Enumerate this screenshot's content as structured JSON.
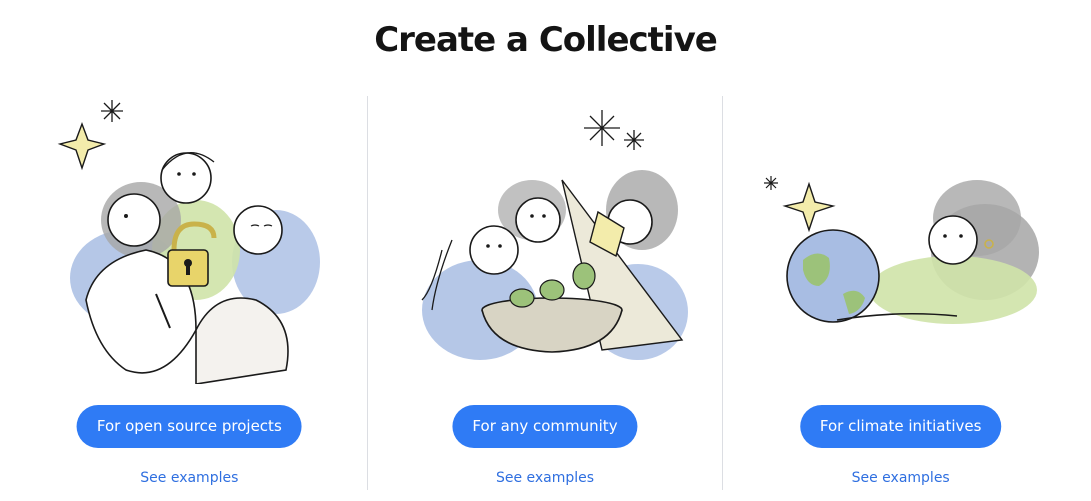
{
  "page": {
    "title": "Create a Collective"
  },
  "cards": [
    {
      "illustration": "people-unlocking-padlock-illustration",
      "button_label": "For open source projects",
      "link_label": "See examples"
    },
    {
      "illustration": "people-sharing-salad-bowl-illustration",
      "button_label": "For any community",
      "link_label": "See examples"
    },
    {
      "illustration": "woman-hugging-earth-illustration",
      "button_label": "For climate initiatives",
      "link_label": "See examples"
    }
  ],
  "colors": {
    "button_bg": "#2f7bf5",
    "link": "#2f6fe0",
    "wash_blue": "#a8bde3",
    "wash_green": "#cfe3a9",
    "wash_gray": "#a6a6a6",
    "star_yellow": "#f3ecab"
  }
}
